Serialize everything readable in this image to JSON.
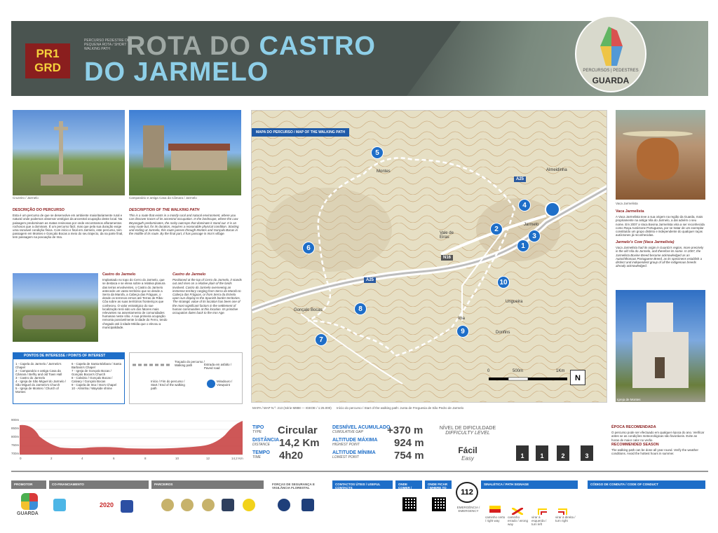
{
  "header": {
    "badge_line1": "PR1",
    "badge_line2": "GRD",
    "subtitle": "PERCURSO PEDESTRE DE PEQUENA ROTA / SHORT WALKING PATH",
    "title_line1_part1": "ROTA DO",
    "title_line1_part2": "CASTRO",
    "title_line2": "DO JARMELO",
    "logo_line1": "PERCURSOS | PEDESTRES",
    "logo_line2": "GUARDA"
  },
  "photos": {
    "cruzeiro_caption": "Cruzeiro / Jarmelo",
    "campanario_caption": "Campanário e antiga Casa da Câmara / Jarmelo",
    "vaca_caption": "Vaca Jarmelista",
    "igreja_caption": "Igreja de Montes"
  },
  "description": {
    "pt_title": "DESCRIÇÃO DO PERCURSO",
    "pt_text": "Esta é um percurso de que se desenvolve em ambiente maioritariamente rural e natural onde podemos observar vestígios da ancestral ocupação deste local. Na paisagem predominam as matas resinosas por onde encontramos afloramentos rochosos que a dominam. É um percurso fácil, mas que pela sua duração exige uma razoável condição física. Com início e final em Jarmelo, este percurso, tem passagem em Montes e Gonçalo Bocas a meio do seu trajecto, da na parte final, tem passagem na povoação de Ima.",
    "en_title": "DESCRIPTION OF THE WALKING PATH",
    "en_text": "This is a route that exists in a mostly rural and natural environment, where you can discover traces of its ancestral occupation. In the landscape, where the Low Beyonguth predominates, the rocky outcrops that dominate it stand out. It is an easy route but, for its duration, requires a reasonable physical condition. Starting and ending at Jarmelo, this route passes through Montes and Gonçalo Bocas in the middle of its route. By the final part, it has passage in Ima's village."
  },
  "castro": {
    "pt_title": "Castro do Jarmelo",
    "pt_text": "Implantado no topo do Cerro do Jarmelo, que se destaca e se eleva sobre a relativa planura das terras envolventes, o Castro do Jarmelo antecede um vasto território que se desde a Serra da Marofa, a Cabeça das Fráguas, o desde os terrenos ermos até Terras de Riba-Côa sobre as suas territórios fronteiriços que conheceu. O valor estratégico do sue localização terá sido um dos fatores mais relevantes na assentamento de comunidades humanas neste sítio. A sua primeira ocupação remonta possivelmente à Idade do Ferro, tendo chegado até à Idade Média que o elevou a municipalidade.",
    "en_title": "Castro do Jarmelo",
    "en_text": "Positioned at the top of Cerro do Jarmelo, it stands out and rises on a relative plain of the lands involved. Castro do Jarmelo overseeing an immense territory ranging from Serra da Marofa to Cabeça das Fráguas, or from Serra da Estrela open sun display to the Spanish border territories. The strategic value of its location has been one of the most significant factors in the settlement of human communities at this location. Its primitive occupation dates back to the Iron Age."
  },
  "vaca": {
    "pt_title": "Vaca Jarmelista",
    "pt_text": "A Vaca Jarmelista teve a sua origem na região da Guarda, mais propriamente na antiga Vila do Jarmelo, a daí advém o seu nome. Em 2007 a Vaca Bovina Jarmelista viria a ser reconhecida como Raça Autóctone Portuguesa, por se tratar de um exemplar constituído um grupo distinto e independente do qualquer raças autóctones já reconhecidas.",
    "en_title": "Jarmelo's Cow (Vaca Jarmelista)",
    "en_text": "Vaca Jarmelista had its origin in Guarda's region, more precisely in the old Vila do Jarmelo, and therefore its name. In 2007, the Jarmelista Bovine Breed became acknowledged as an Autochthonous Portuguese Breed, as its specimens establish a distinct and independent group of all the indigenous breeds already acknowledged."
  },
  "map": {
    "label": "MAPA DO PERCURSO / MAP OF THE WALKING PATH",
    "places": [
      "Montes",
      "Almeidinha",
      "Jarmelo",
      "Vale de Eiras",
      "Ungueira",
      "Gonçalo Bocas",
      "Ima",
      "Donfins"
    ],
    "roads": [
      "A25",
      "A25",
      "N16"
    ],
    "poi_numbers": [
      "1",
      "2",
      "3",
      "4",
      "5",
      "6",
      "7",
      "8",
      "9",
      "10"
    ],
    "scale_0": "0",
    "scale_500": "500m",
    "scale_1k": "1Km",
    "north": "N",
    "footer_text": "MAPA / MAP N.º: 213 (Série M888 — IGEOE / 1:25.000)",
    "start_text": "Início do percurso / Start of the walking path: Junta de Freguesia de São Pedro de Jarmelo"
  },
  "poi_list": {
    "title": "PONTOS DE INTERESSE / POINTS OF INTEREST",
    "col1": [
      "1 - Capela do Jarmelo / Jarmelo's Chapel",
      "2 - Campanário e antiga Casa da Câmara / Belfry and old Town Hall",
      "3 - Castro do Jarmelo",
      "4 - Igreja de São Miguel do Jarmelo / São Miguel do Jarmelo's Church",
      "5 - Igreja de Montes / Church of Montes"
    ],
    "col2": [
      "6 - Capela de Santa Bárbara / Santa Barbara's Chapel",
      "7 - Igreja de Gonçalo Bocas / Gonçalo Bocas's Church",
      "8 - Calvário / Gonçalo Bocas / Calvary / Gonçalo Bocas",
      "9 - Capela de Ima / Ima's Chapel",
      "10 - Alminha / Wayside shrine"
    ],
    "legend_path": "Traçado do percurso / Walking path",
    "legend_start": "Início / Fim do percurso / Start / End of the walking path",
    "legend_road": "Estrada em asfalto / Paved road",
    "legend_view": "Miradouro / Viewpoint"
  },
  "profile": {
    "y_ticks": [
      "900m",
      "850m",
      "800m",
      "750m",
      "700m"
    ],
    "x_ticks": [
      "0",
      "2",
      "4",
      "6",
      "8",
      "10",
      "12",
      "14,2 Km"
    ]
  },
  "stats": {
    "type_lbl": "TIPO",
    "type_lbl_en": "TYPE",
    "type_val": "Circular",
    "dist_lbl": "DISTÂNCIA",
    "dist_lbl_en": "DISTANCE",
    "dist_val": "14,2 Km",
    "time_lbl": "TEMPO",
    "time_lbl_en": "TIME",
    "time_val": "4h20",
    "gain_lbl": "DESNÍVEL ACUMULADO",
    "gain_lbl_en": "CUMULATIVE GAP",
    "gain_val": "+370 m",
    "max_lbl": "ALTITUDE MÁXIMA",
    "max_lbl_en": "HIGHEST POINT",
    "max_val": "924 m",
    "min_lbl": "ALTITUDE MÍNIMA",
    "min_lbl_en": "LOWEST POINT",
    "min_val": "754 m",
    "diff_lbl": "NÍVEL DE DIFICULDADE",
    "diff_lbl_en": "DIFFICULTY LEVEL",
    "diff_val": "Fácil",
    "diff_val_en": "Easy",
    "diff_boxes": [
      "1",
      "1",
      "2",
      "3"
    ]
  },
  "epoca": {
    "title": "ÉPOCA RECOMENDADA",
    "text": "O percurso pode ser efectuado em qualquer época do ano. Verificar antes se as condições meteorológicas são favoráveis. Evite as horas de maior calor no verão.",
    "en_title": "RECOMMENDED SEASON",
    "en_text": "The walking path can be done all year round. Verify the weather conditions. Avoid the hottest hours in summer."
  },
  "footer": {
    "promotor": "PROMOTOR",
    "cofinanc": "CO-FINANCIAMENTO",
    "parceiros": "PARCEIROS",
    "forcas": "FORÇAS DE SEGURANÇA E VIGILÂNCIA FLORESTAL",
    "contactos": "CONTACTOS ÚTEIS / USEFUL CONTACTS",
    "onde_comer": "ONDE COMER / WHERE TO EAT",
    "onde_ficar": "ONDE FICAR / WHERE TO STAY",
    "emergencia": "112",
    "emergencia_lbl": "EMERGÊNCIA / EMERGENCY",
    "sinaletica": "SINALÉTICA / PATH SIGNAGE",
    "sign_labels": [
      "caminho certo / right way",
      "caminho errado / wrong way",
      "virar à esquerda / turn left",
      "virar à direita / turn right"
    ],
    "conduta": "CÓDIGO DE CONDUTA / CODE OF CONDUCT",
    "guarda": "GUARDA",
    "portugal2020": "2020"
  },
  "colors": {
    "header_bg": "#4a5450",
    "accent_red": "#8a1e1e",
    "accent_blue": "#1e6ec8",
    "title_blue": "#8ecfe8"
  }
}
